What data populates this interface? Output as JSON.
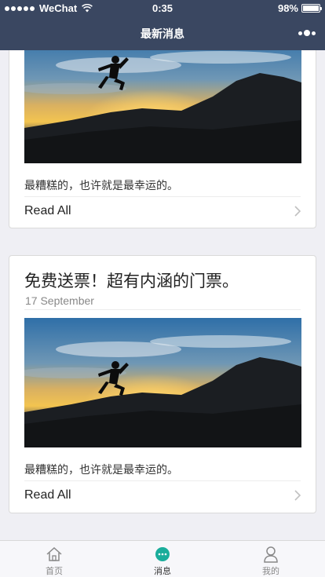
{
  "status_bar": {
    "carrier": "WeChat",
    "time": "0:35",
    "battery": "98%",
    "battery_level": 0.98
  },
  "nav": {
    "title": "最新消息"
  },
  "cards": [
    {
      "title": "",
      "date": "",
      "excerpt": "最糟糕的，也许就是最幸运的。",
      "read_all": "Read All"
    },
    {
      "title": "免费送票！超有内涵的门票。",
      "date": "17 September",
      "excerpt": "最糟糕的，也许就是最幸运的。",
      "read_all": "Read All"
    }
  ],
  "tabs": [
    {
      "label": "首页",
      "icon": "home-icon",
      "active": false
    },
    {
      "label": "消息",
      "icon": "chat-icon",
      "active": true
    },
    {
      "label": "我的",
      "icon": "profile-icon",
      "active": false
    }
  ],
  "colors": {
    "nav_bg": "#3a4761",
    "accent": "#1aad9b",
    "page_bg": "#efeff4"
  }
}
